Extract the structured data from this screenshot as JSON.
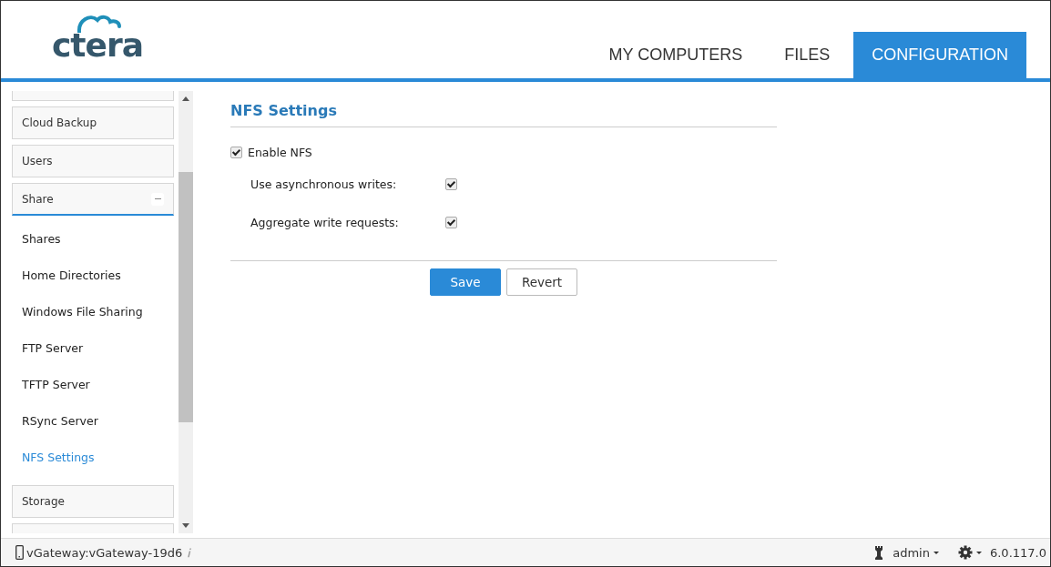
{
  "logo": {
    "text": "ctera"
  },
  "tabs": [
    {
      "label": "MY COMPUTERS",
      "selected": false
    },
    {
      "label": "FILES",
      "selected": false
    },
    {
      "label": "CONFIGURATION",
      "selected": true
    }
  ],
  "sidebar": {
    "items": [
      {
        "label": "Cloud Backup",
        "expanded": false
      },
      {
        "label": "Users",
        "expanded": false
      },
      {
        "label": "Share",
        "expanded": true,
        "children": [
          {
            "label": "Shares",
            "selected": false
          },
          {
            "label": "Home Directories",
            "selected": false
          },
          {
            "label": "Windows File Sharing",
            "selected": false
          },
          {
            "label": "FTP Server",
            "selected": false
          },
          {
            "label": "TFTP Server",
            "selected": false
          },
          {
            "label": "RSync Server",
            "selected": false
          },
          {
            "label": "NFS Settings",
            "selected": true
          }
        ]
      },
      {
        "label": "Storage",
        "expanded": false
      }
    ]
  },
  "panel": {
    "title": "NFS Settings",
    "enable": {
      "label": "Enable NFS",
      "checked": true
    },
    "options": [
      {
        "label": "Use asynchronous writes:",
        "checked": true
      },
      {
        "label": "Aggregate write requests:",
        "checked": true
      }
    ],
    "buttons": [
      {
        "label": "Save",
        "kind": "primary"
      },
      {
        "label": "Revert",
        "kind": "secondary"
      }
    ]
  },
  "status_bar": {
    "device": "vGateway:vGateway-19d6",
    "user": "admin",
    "version": "6.0.117.0"
  }
}
